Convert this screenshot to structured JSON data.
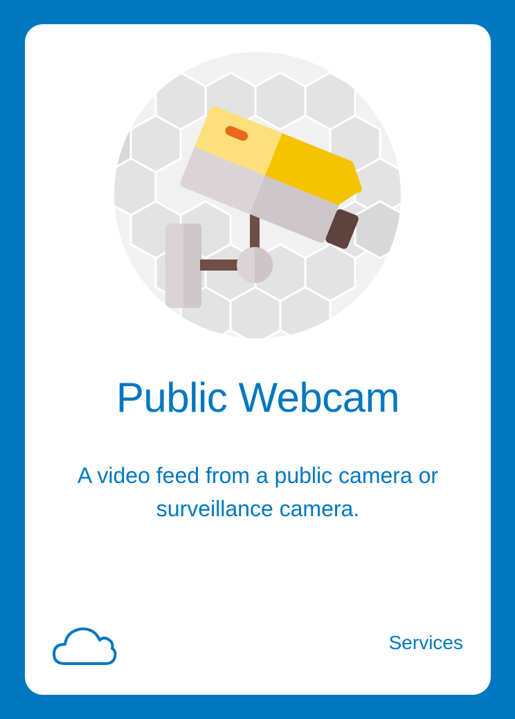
{
  "card": {
    "title": "Public Webcam",
    "description": "A video feed from a public camera or surveillance camera.",
    "category": "Services"
  },
  "icons": {
    "illustration": "security-camera-icon",
    "footer": "cloud-icon"
  },
  "colors": {
    "background": "#0077c0",
    "card": "#ffffff",
    "text": "#0077c0",
    "camera_body_light": "#fde07a",
    "camera_body": "#f5c400",
    "camera_led": "#e8691e",
    "camera_mount": "#d9cfd3",
    "camera_pole": "#6b4b43"
  }
}
